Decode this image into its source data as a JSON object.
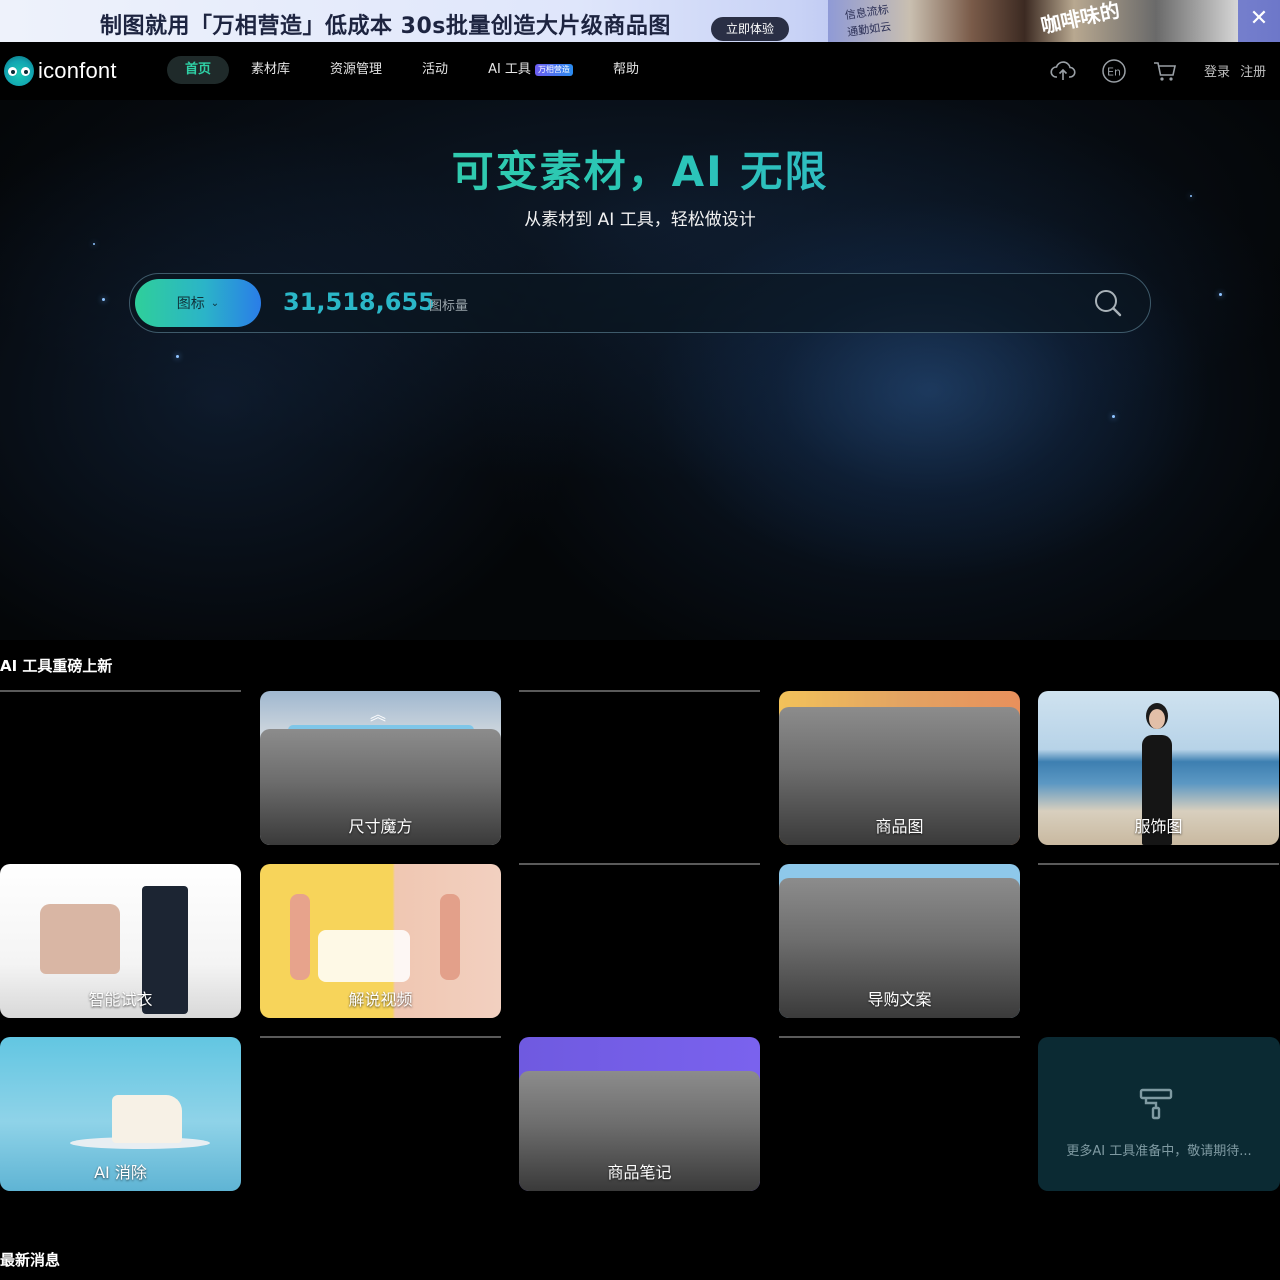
{
  "banner": {
    "text": "制图就用「万相营造」低成本 30s批量创造大片级商品图",
    "cta": "立即体验",
    "art_tag": "信息流标\n通勤如云",
    "art_tag2": "咖啡味的",
    "close_icon": "close-icon"
  },
  "header": {
    "logo_text": "iconfont",
    "nav": [
      {
        "label": "首页",
        "active": true
      },
      {
        "label": "素材库",
        "active": false
      },
      {
        "label": "资源管理",
        "active": false
      },
      {
        "label": "活动",
        "active": false
      },
      {
        "label": "AI 工具",
        "badge": "万相营造",
        "active": false
      },
      {
        "label": "帮助",
        "active": false
      }
    ],
    "icons": [
      "upload-cloud-icon",
      "language-en-icon",
      "cart-icon"
    ],
    "lang_label": "En",
    "login": "登录",
    "register": "注册"
  },
  "hero": {
    "title": "可变素材，AI 无限",
    "subtitle": "从素材到 AI 工具，轻松做设计",
    "search": {
      "type": "图标",
      "count": "31,518,655",
      "count_label": "图标量",
      "placeholder": ""
    }
  },
  "ai_tools": {
    "title": "AI 工具重磅上新",
    "cards": [
      {
        "label": ""
      },
      {
        "label": "尺寸魔方"
      },
      {
        "label": ""
      },
      {
        "label": "商品图"
      },
      {
        "label": "服饰图"
      },
      {
        "label": "智能试衣"
      },
      {
        "label": "解说视频"
      },
      {
        "label": ""
      },
      {
        "label": "导购文案"
      },
      {
        "label": ""
      },
      {
        "label": "AI 消除"
      },
      {
        "label": ""
      },
      {
        "label": "商品笔记"
      },
      {
        "label": ""
      }
    ],
    "more_text": "更多AI 工具准备中，敬请期待..."
  },
  "news": {
    "title": "最新消息"
  },
  "colors": {
    "accent": "#2fd1a6",
    "count": "#2bb7c8",
    "background": "#000000"
  }
}
